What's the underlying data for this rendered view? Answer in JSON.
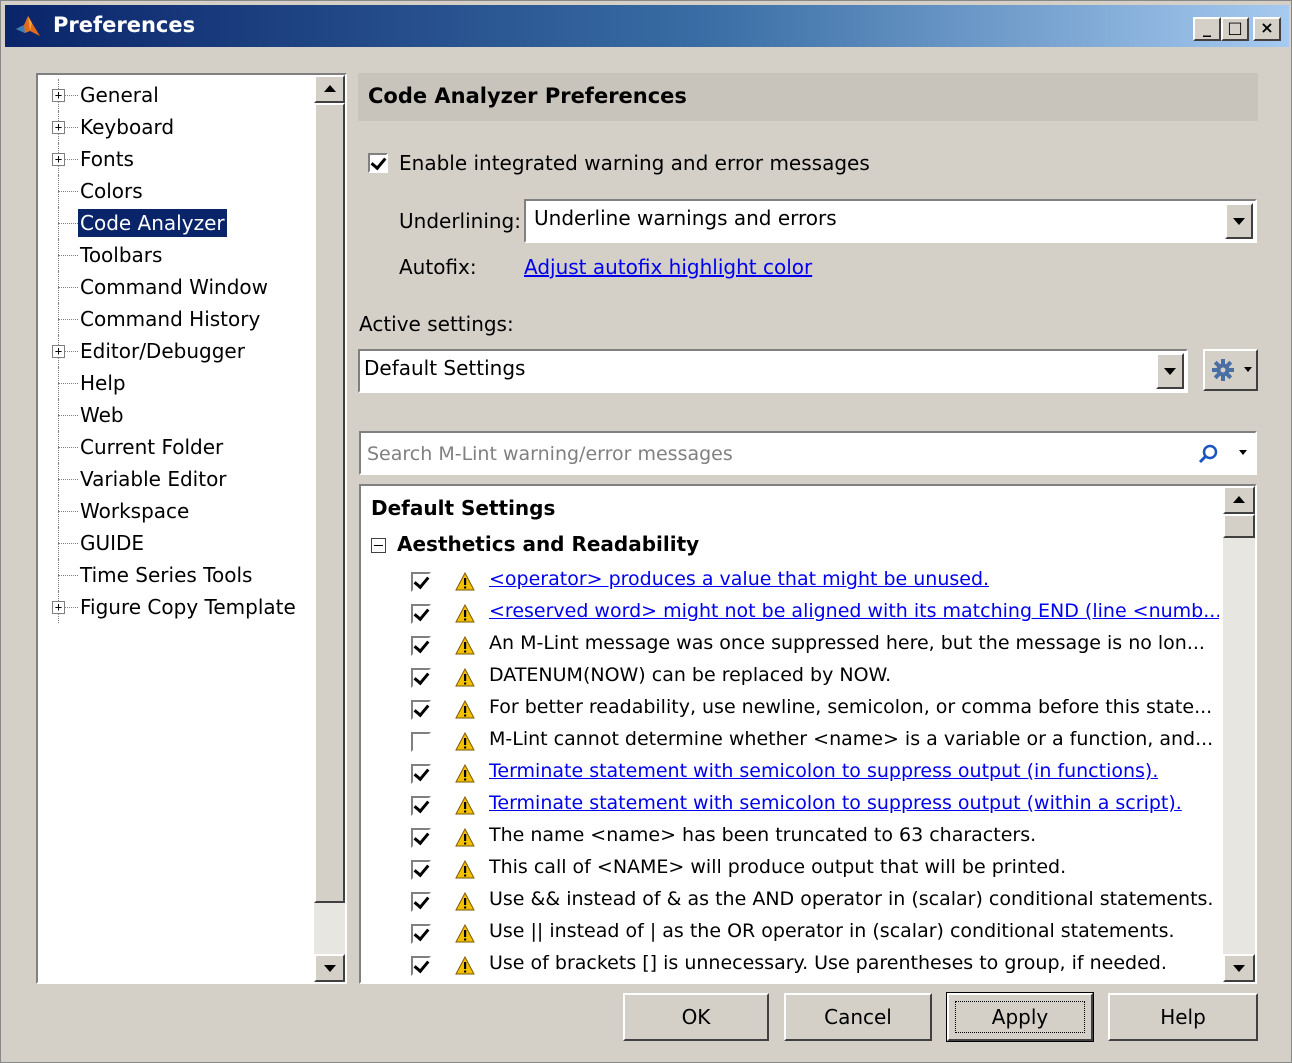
{
  "window": {
    "title": "Preferences",
    "controls": {
      "minimize": "_",
      "maximize": "□",
      "close": "×"
    }
  },
  "tree": {
    "items": [
      {
        "label": "General",
        "expandable": true,
        "selected": false
      },
      {
        "label": "Keyboard",
        "expandable": true,
        "selected": false
      },
      {
        "label": "Fonts",
        "expandable": true,
        "selected": false
      },
      {
        "label": "Colors",
        "expandable": false,
        "selected": false
      },
      {
        "label": "Code Analyzer",
        "expandable": false,
        "selected": true
      },
      {
        "label": "Toolbars",
        "expandable": false,
        "selected": false
      },
      {
        "label": "Command Window",
        "expandable": false,
        "selected": false
      },
      {
        "label": "Command History",
        "expandable": false,
        "selected": false
      },
      {
        "label": "Editor/Debugger",
        "expandable": true,
        "selected": false
      },
      {
        "label": "Help",
        "expandable": false,
        "selected": false
      },
      {
        "label": "Web",
        "expandable": false,
        "selected": false
      },
      {
        "label": "Current Folder",
        "expandable": false,
        "selected": false
      },
      {
        "label": "Variable Editor",
        "expandable": false,
        "selected": false
      },
      {
        "label": "Workspace",
        "expandable": false,
        "selected": false
      },
      {
        "label": "GUIDE",
        "expandable": false,
        "selected": false
      },
      {
        "label": "Time Series Tools",
        "expandable": false,
        "selected": false
      },
      {
        "label": "Figure Copy Template",
        "expandable": true,
        "selected": false
      }
    ]
  },
  "panel": {
    "header": "Code Analyzer Preferences",
    "enable_label": "Enable integrated warning and error messages",
    "enable_checked": true,
    "underlining_label": "Underlining:",
    "underlining_value": "Underline warnings and errors",
    "autofix_label": "Autofix:",
    "autofix_link": "Adjust autofix highlight color",
    "active_settings_label": "Active settings:",
    "active_settings_value": "Default Settings",
    "search_placeholder": "Search M-Lint warning/error messages"
  },
  "messages": {
    "title": "Default Settings",
    "group": "Aesthetics and Readability",
    "rows": [
      {
        "text": "<operator> produces a value that might be unused.",
        "checked": true,
        "link": true
      },
      {
        "text": "<reserved word> might not be aligned with its matching END (line <numb...",
        "checked": true,
        "link": true
      },
      {
        "text": "An M-Lint message was once suppressed here, but the message is no lon...",
        "checked": true,
        "link": false
      },
      {
        "text": "DATENUM(NOW) can be replaced by NOW.",
        "checked": true,
        "link": false
      },
      {
        "text": "For better readability, use newline, semicolon, or comma before this state...",
        "checked": true,
        "link": false
      },
      {
        "text": "M-Lint cannot determine whether <name> is a variable or a function, and...",
        "checked": false,
        "link": false
      },
      {
        "text": "Terminate statement with semicolon to suppress output (in functions).",
        "checked": true,
        "link": true
      },
      {
        "text": "Terminate statement with semicolon to suppress output (within a script).",
        "checked": true,
        "link": true
      },
      {
        "text": "The name <name> has been truncated to 63 characters.",
        "checked": true,
        "link": false
      },
      {
        "text": "This call of <NAME> will produce output that will be printed.",
        "checked": true,
        "link": false
      },
      {
        "text": "Use && instead of & as the AND operator in (scalar) conditional statements.",
        "checked": true,
        "link": false
      },
      {
        "text": "Use || instead of | as the OR operator in (scalar) conditional statements.",
        "checked": true,
        "link": false
      },
      {
        "text": "Use of brackets [] is unnecessary. Use parentheses to group, if needed.",
        "checked": true,
        "link": false
      }
    ]
  },
  "buttons": {
    "ok": "OK",
    "cancel": "Cancel",
    "apply": "Apply",
    "help": "Help"
  },
  "colors": {
    "selection": "#0a246a",
    "link": "#0000ee",
    "warning": "#f4c000"
  }
}
